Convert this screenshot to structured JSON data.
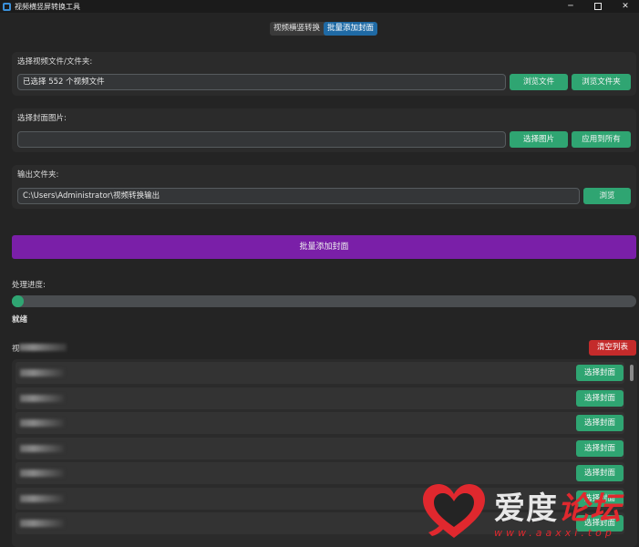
{
  "window": {
    "title": "视频横竖屏转换工具",
    "minimize": "─",
    "close": "✕"
  },
  "tabs": [
    {
      "label": "视频横竖转换"
    },
    {
      "label": "批量添加封面"
    }
  ],
  "video_section": {
    "label": "选择视频文件/文件夹:",
    "value": "已选择 552 个视频文件",
    "browse_file": "浏览文件",
    "browse_folder": "浏览文件夹"
  },
  "cover_section": {
    "label": "选择封面图片:",
    "value": "",
    "select_image": "选择图片",
    "apply_all": "应用到所有"
  },
  "output_section": {
    "label": "输出文件夹:",
    "value": "C:\\Users\\Administrator\\视频转换输出",
    "browse": "浏览"
  },
  "action": {
    "label": "批量添加封面"
  },
  "progress": {
    "label": "处理进度:",
    "value": 0,
    "status": "就绪"
  },
  "list": {
    "header_prefix": "视",
    "clear_label": "清空列表",
    "row_button": "选择封面",
    "rows": [
      "",
      "",
      "",
      "",
      "",
      "",
      ""
    ]
  },
  "watermark": {
    "text_white": "爱度",
    "text_red": "论坛",
    "url": "www.aaxxi.top"
  },
  "colors": {
    "accent_green": "#2fa572",
    "accent_purple": "#7a1fa8",
    "danger_red": "#c42b2b",
    "tab_active": "#1f6aa5"
  }
}
